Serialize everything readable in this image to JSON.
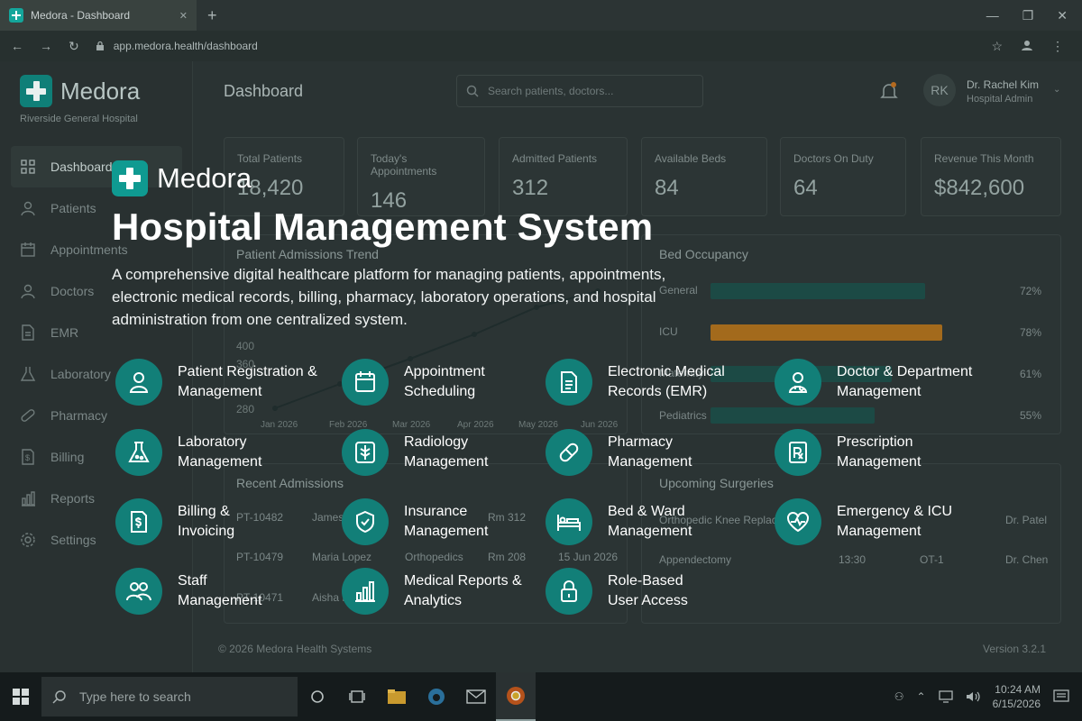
{
  "browser": {
    "tab_title": "Medora - Dashboard",
    "new_tab": "+",
    "url": "app.medora.health/dashboard",
    "min": "—",
    "max": "❐",
    "close": "✕"
  },
  "app": {
    "logo": "Medora",
    "hospital": "Riverside General Hospital",
    "nav": [
      {
        "label": "Dashboard",
        "icon": "grid-icon"
      },
      {
        "label": "Patients",
        "icon": "user-icon"
      },
      {
        "label": "Appointments",
        "icon": "calendar-icon"
      },
      {
        "label": "Doctors",
        "icon": "doctor-icon"
      },
      {
        "label": "EMR",
        "icon": "document-icon"
      },
      {
        "label": "Laboratory",
        "icon": "flask-icon"
      },
      {
        "label": "Pharmacy",
        "icon": "pill-icon"
      },
      {
        "label": "Billing",
        "icon": "invoice-icon"
      },
      {
        "label": "Reports",
        "icon": "bar-chart-icon"
      },
      {
        "label": "Settings",
        "icon": "gear-icon"
      }
    ],
    "page_title": "Dashboard",
    "search_placeholder": "Search patients, doctors...",
    "user": {
      "initials": "RK",
      "name": "Dr. Rachel Kim",
      "role": "Hospital Admin"
    },
    "stats": [
      {
        "label": "Total Patients",
        "value": "18,420"
      },
      {
        "label": "Today's Appointments",
        "value": "146"
      },
      {
        "label": "Admitted Patients",
        "value": "312"
      },
      {
        "label": "Available Beds",
        "value": "84"
      },
      {
        "label": "Doctors On Duty",
        "value": "64"
      },
      {
        "label": "Revenue This Month",
        "value": "$842,600"
      }
    ],
    "admissions": {
      "title": "Patient Admissions Trend",
      "y_ticks": [
        "400",
        "360",
        "280"
      ],
      "months": [
        "Jan 2026",
        "Feb 2026",
        "Mar 2026",
        "Apr 2026",
        "May 2026",
        "Jun 2026"
      ]
    },
    "beds": {
      "title": "Bed Occupancy",
      "rows": [
        {
          "label": "General",
          "pct": "72%",
          "value": 72,
          "color": "#1c4a45"
        },
        {
          "label": "ICU",
          "pct": "78%",
          "value": 78,
          "color": "#a36a1c"
        },
        {
          "label": "Maternity",
          "pct": "61%",
          "value": 61,
          "color": "#1c4a45"
        },
        {
          "label": "Pediatrics",
          "pct": "55%",
          "value": 55,
          "color": "#1c4a45"
        }
      ]
    },
    "recent": {
      "title": "Recent Admissions",
      "rows": [
        {
          "id": "PT-10482",
          "name": "James R",
          "dept": "",
          "room": "Rm 312",
          "date": ""
        },
        {
          "id": "PT-10479",
          "name": "Maria Lopez",
          "dept": "Orthopedics",
          "room": "Rm 208",
          "date": "15 Jun 2026"
        },
        {
          "id": "PT-10471",
          "name": "Aisha R",
          "dept": "",
          "room": "",
          "date": ""
        }
      ]
    },
    "surgeries": {
      "title": "Upcoming Surgeries",
      "rows": [
        {
          "name": "Orthopedic Knee Replace",
          "time": "",
          "room": "",
          "doctor": "Dr. Patel"
        },
        {
          "name": "Appendectomy",
          "time": "13:30",
          "room": "OT-1",
          "doctor": "Dr. Chen"
        }
      ]
    },
    "footer": {
      "copyright": "© 2026 Medora Health Systems",
      "version": "Version 3.2.1"
    }
  },
  "overlay": {
    "brand": "Medora",
    "title": "Hospital Management System",
    "description": "A comprehensive digital healthcare platform for managing patients, appointments, electronic medical records, billing, pharmacy, laboratory operations, and hospital administration from one centralized system.",
    "features": [
      {
        "label": "Patient Registration &\nManagement",
        "icon": "patient-icon"
      },
      {
        "label": "Appointment\nScheduling",
        "icon": "calendar-icon"
      },
      {
        "label": "Electronic Medical\nRecords (EMR)",
        "icon": "document-icon"
      },
      {
        "label": "Doctor & Department\nManagement",
        "icon": "doctor-icon"
      },
      {
        "label": "Laboratory\nManagement",
        "icon": "flask-icon"
      },
      {
        "label": "Radiology\nManagement",
        "icon": "xray-icon"
      },
      {
        "label": "Pharmacy\nManagement",
        "icon": "pill-icon"
      },
      {
        "label": "Prescription\nManagement",
        "icon": "prescription-icon"
      },
      {
        "label": "Billing &\nInvoicing",
        "icon": "invoice-icon"
      },
      {
        "label": "Insurance\nManagement",
        "icon": "shield-icon"
      },
      {
        "label": "Bed & Ward\nManagement",
        "icon": "bed-icon"
      },
      {
        "label": "Emergency & ICU\nManagement",
        "icon": "heart-pulse-icon"
      },
      {
        "label": "Staff\nManagement",
        "icon": "staff-icon"
      },
      {
        "label": "Medical Reports &\nAnalytics",
        "icon": "bar-chart-icon"
      },
      {
        "label": "Role-Based\nUser Access",
        "icon": "lock-icon"
      }
    ]
  },
  "taskbar": {
    "search_placeholder": "Type here to search",
    "time": "10:24 AM",
    "date": "6/15/2026"
  }
}
